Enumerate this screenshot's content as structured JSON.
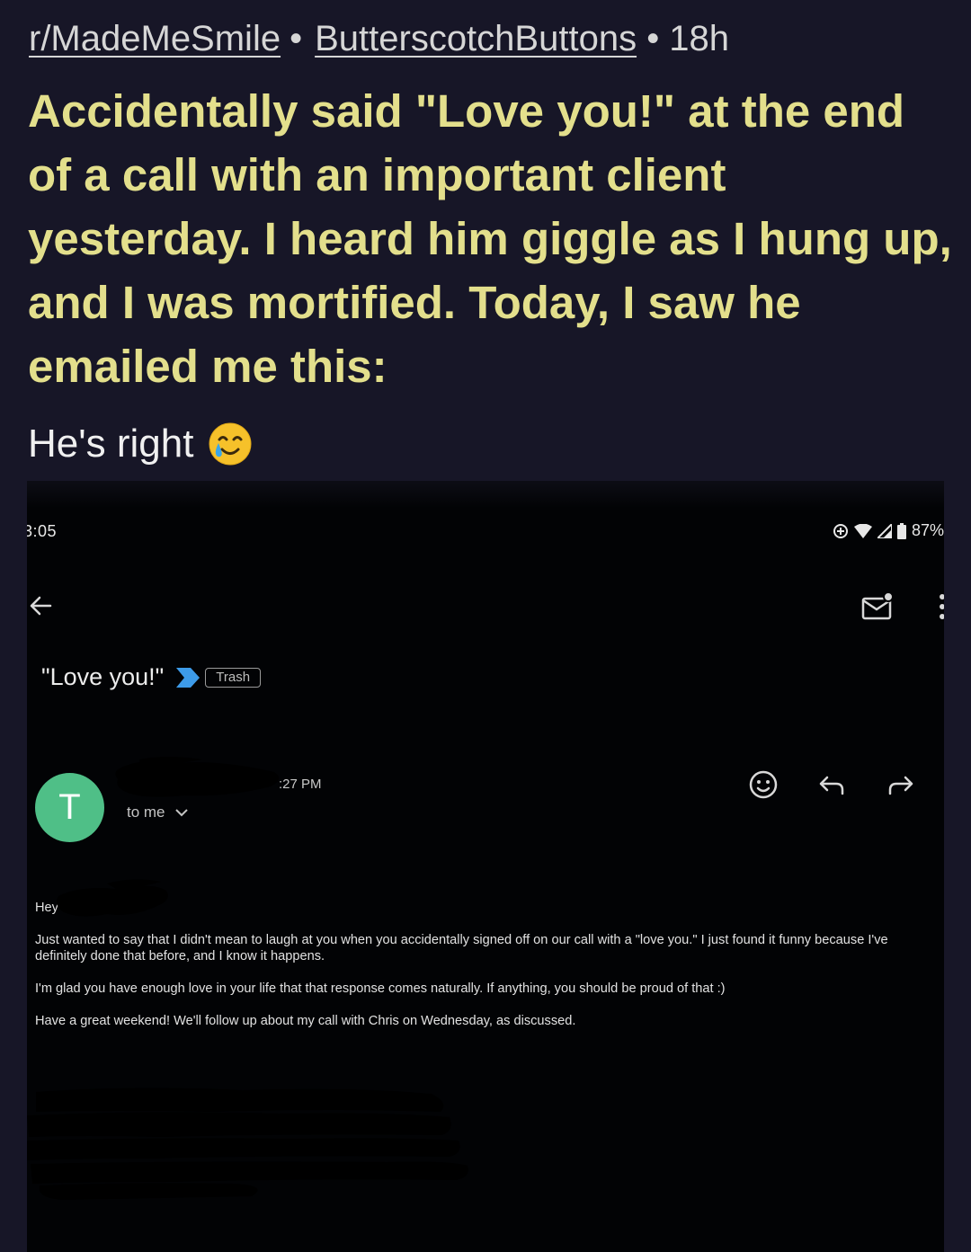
{
  "post": {
    "subreddit": "r/MadeMeSmile",
    "separator": "•",
    "author": "ButterscotchButtons",
    "age": "• 18h",
    "title": "Accidentally said \"Love you!\" at the end of a call with an important client yesterday. I heard him giggle as I hung up, and I was mortified. Today, I saw he emailed me this:",
    "body": "He's right",
    "emoji": "smiling-face-with-tear-icon"
  },
  "screenshot": {
    "status_bar": {
      "time": "3:05",
      "battery": "87%"
    },
    "subject": "\"Love you!\"",
    "label_chip": "Trash",
    "sender": {
      "avatar_letter": "T",
      "time": ":27 PM",
      "recipient": "to me"
    },
    "email": {
      "greeting": "Hey",
      "paragraphs": [
        "Just wanted to say that I didn't mean to laugh at you when you accidentally signed off on our call with a \"love you.\" I just found it funny because I've definitely done that before, and I know it happens.",
        "I'm glad you have enough love in your life that that response comes naturally. If anything, you should be proud of that :)",
        "Have a great weekend! We'll follow up about my call with Chris on Wednesday, as discussed."
      ]
    }
  },
  "colors": {
    "page_bg": "#171627",
    "title": "#e3df8c",
    "avatar": "#4fbf87",
    "label_arrow": "#3d9be9"
  }
}
